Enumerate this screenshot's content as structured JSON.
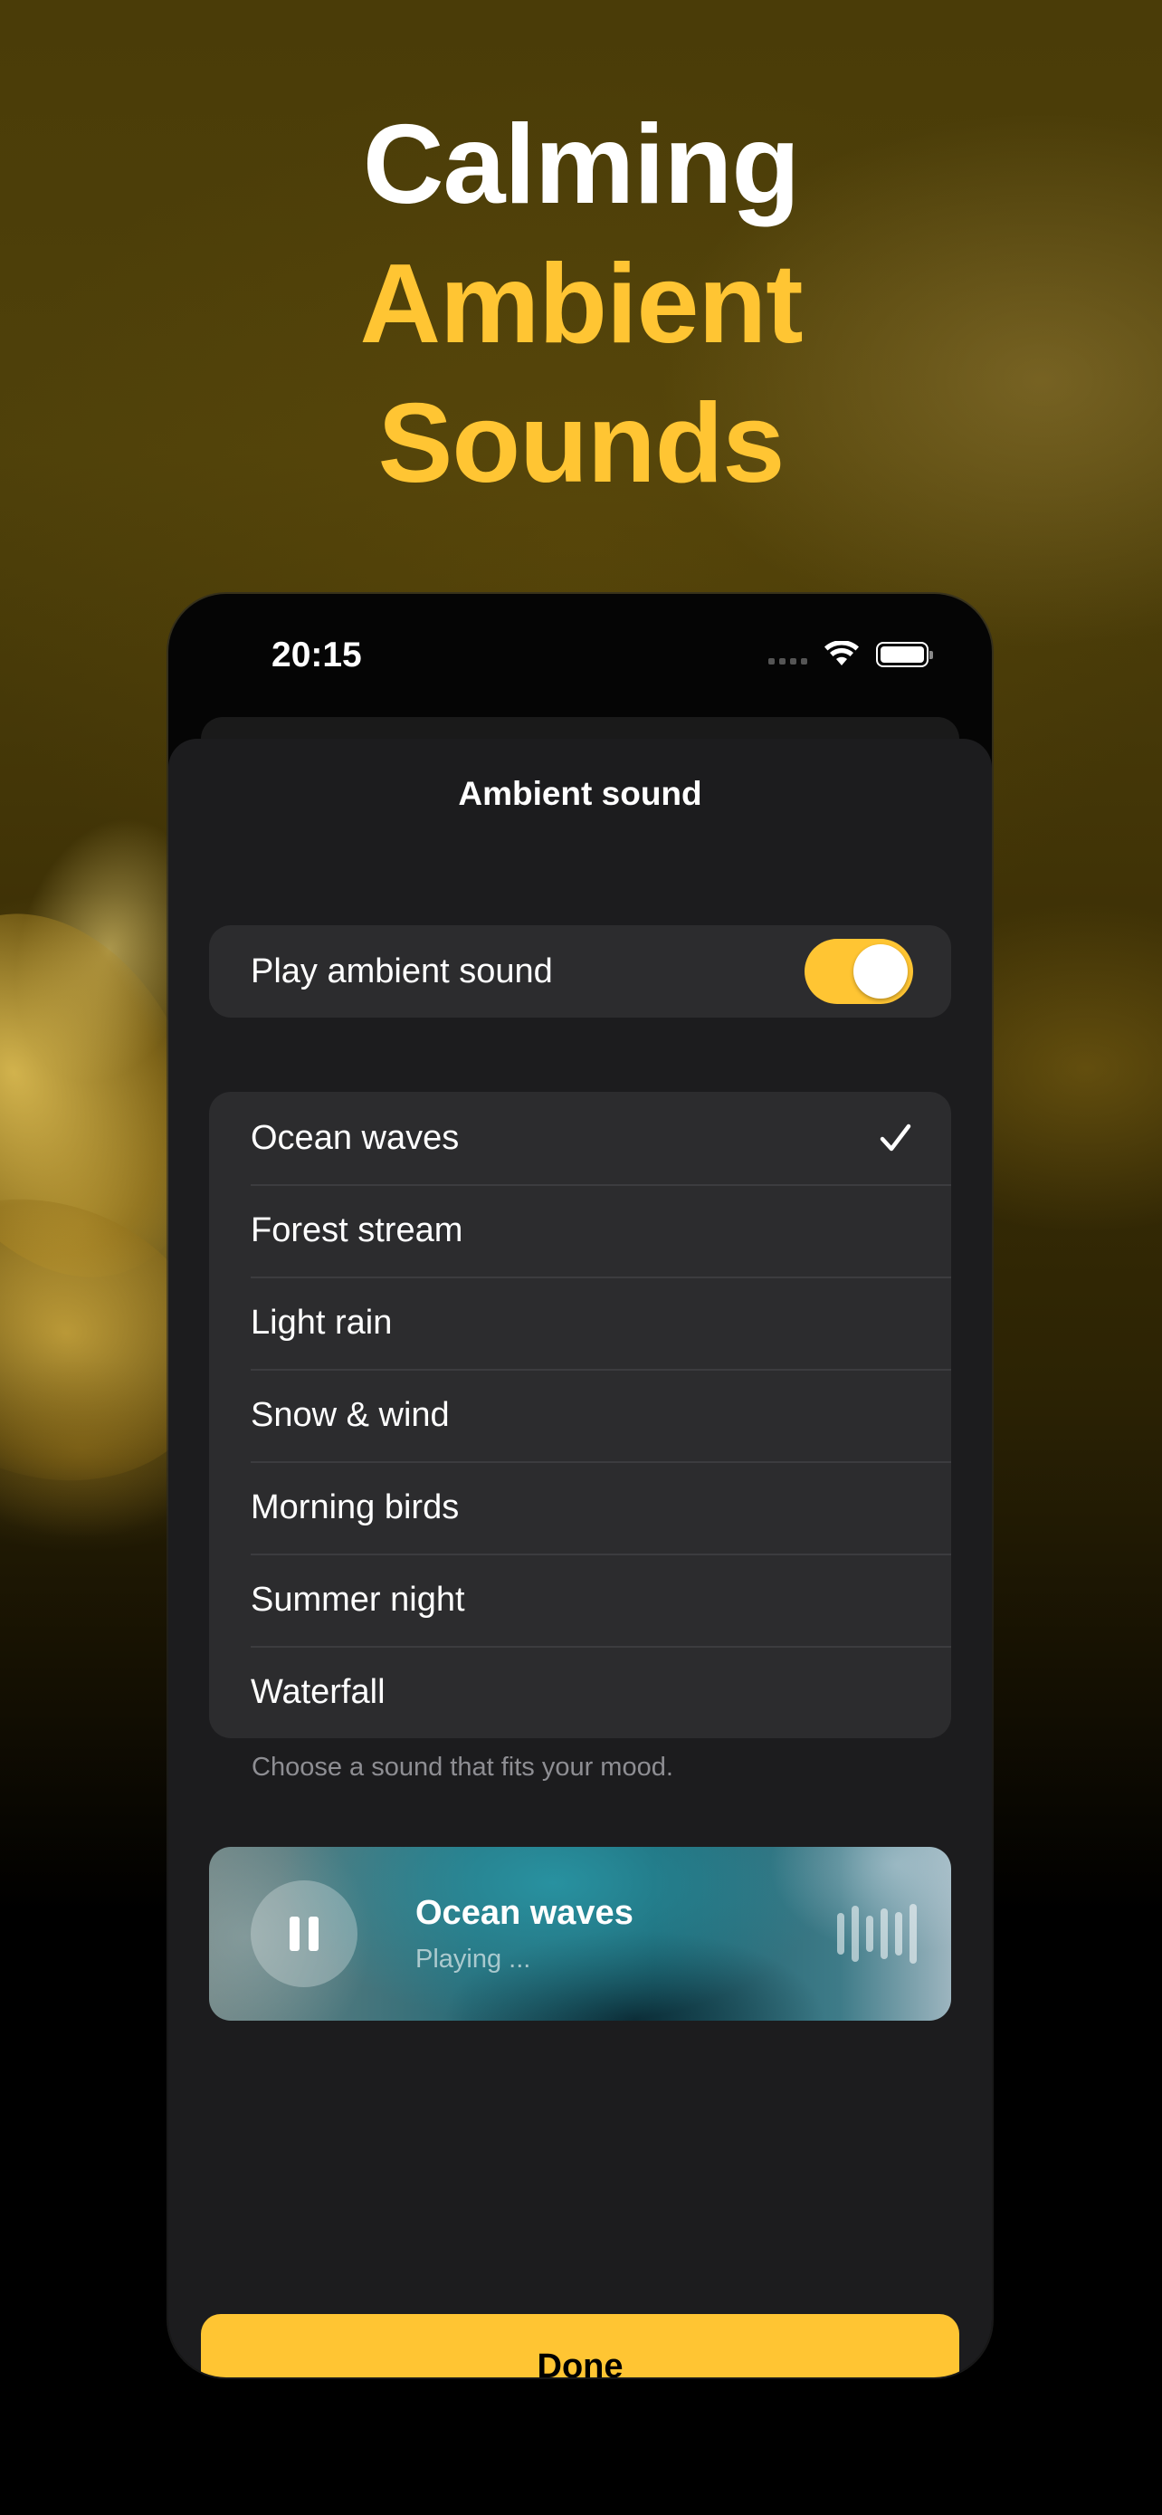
{
  "headline": {
    "line1": "Calming",
    "line2": "Ambient",
    "line3": "Sounds"
  },
  "status_bar": {
    "time": "20:15"
  },
  "sheet": {
    "title": "Ambient sound",
    "toggle": {
      "label": "Play ambient sound",
      "on": true
    },
    "sounds": [
      {
        "label": "Ocean waves",
        "selected": true
      },
      {
        "label": "Forest stream",
        "selected": false
      },
      {
        "label": "Light rain",
        "selected": false
      },
      {
        "label": "Snow & wind",
        "selected": false
      },
      {
        "label": "Morning birds",
        "selected": false
      },
      {
        "label": "Summer night",
        "selected": false
      },
      {
        "label": "Waterfall",
        "selected": false
      }
    ],
    "footnote": "Choose a sound that fits your mood.",
    "player": {
      "title": "Ocean waves",
      "status": "Playing ..."
    },
    "done_label": "Done"
  },
  "colors": {
    "accent": "#ffc533",
    "sheet_bg": "#1c1c1e",
    "cell_bg": "#2c2c2e"
  },
  "icons": [
    "wifi-icon",
    "battery-icon",
    "checkmark-icon",
    "pause-icon",
    "waveform-icon"
  ]
}
